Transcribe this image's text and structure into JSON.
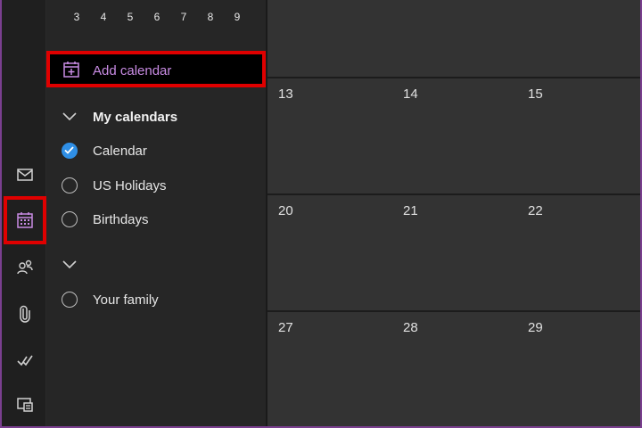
{
  "mini_calendar": {
    "days": [
      "3",
      "4",
      "5",
      "6",
      "7",
      "8",
      "9"
    ]
  },
  "folder_pane": {
    "add_calendar_label": "Add calendar",
    "groups": [
      {
        "label": "My calendars",
        "expanded": true
      },
      {
        "label": "",
        "expanded": true
      }
    ],
    "calendars": [
      {
        "label": "Calendar",
        "checked": true
      },
      {
        "label": "US Holidays",
        "checked": false
      },
      {
        "label": "Birthdays",
        "checked": false
      },
      {
        "label": "Your family",
        "checked": false
      }
    ]
  },
  "rail": {
    "icons": [
      "mail-icon",
      "calendar-icon",
      "people-icon",
      "attachment-icon",
      "todo-icon",
      "groups-icon"
    ],
    "active": "calendar-icon"
  },
  "month_grid": {
    "rows": [
      [
        "13",
        "14",
        "15"
      ],
      [
        "20",
        "21",
        "22"
      ],
      [
        "27",
        "28",
        "29"
      ]
    ]
  },
  "colors": {
    "accent_purple": "#c98ce4",
    "highlight_red": "#e00000",
    "checked_blue": "#2f8fe6",
    "frame_purple": "#7a3f8f"
  }
}
